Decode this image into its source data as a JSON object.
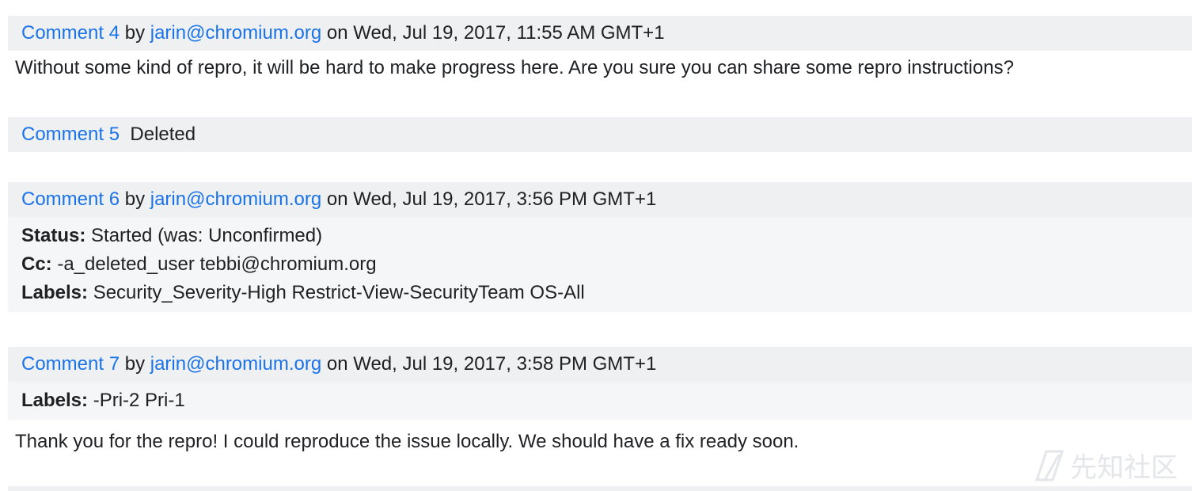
{
  "comments": [
    {
      "id_label": "Comment 4",
      "by": "by",
      "author": "jarin@chromium.org",
      "on": "on",
      "date": "Wed, Jul 19, 2017, 11:55 AM GMT+1",
      "body": "Without some kind of repro, it will be hard to make progress here. Are you sure you can share some repro instructions?"
    },
    {
      "id_label": "Comment 5",
      "status": "Deleted"
    },
    {
      "id_label": "Comment 6",
      "by": "by",
      "author": "jarin@chromium.org",
      "on": "on",
      "date": "Wed, Jul 19, 2017, 3:56 PM GMT+1",
      "amendments": [
        {
          "field": "Status:",
          "value": "Started (was: Unconfirmed)"
        },
        {
          "field": "Cc:",
          "value": "-a_deleted_user tebbi@chromium.org"
        },
        {
          "field": "Labels:",
          "value": "Security_Severity-High Restrict-View-SecurityTeam OS-All"
        }
      ]
    },
    {
      "id_label": "Comment 7",
      "by": "by",
      "author": "jarin@chromium.org",
      "on": "on",
      "date": "Wed, Jul 19, 2017, 3:58 PM GMT+1",
      "amendments": [
        {
          "field": "Labels:",
          "value": "-Pri-2 Pri-1"
        }
      ],
      "body": "Thank you for the repro! I could reproduce the issue locally. We should have a fix ready soon."
    }
  ],
  "watermark": {
    "text": "先知社区",
    "icon": "xianzhi-logo-icon"
  },
  "colors": {
    "link": "#1a73e8",
    "header_bg": "#eff0f2",
    "amend_bg": "#f5f6f8"
  }
}
